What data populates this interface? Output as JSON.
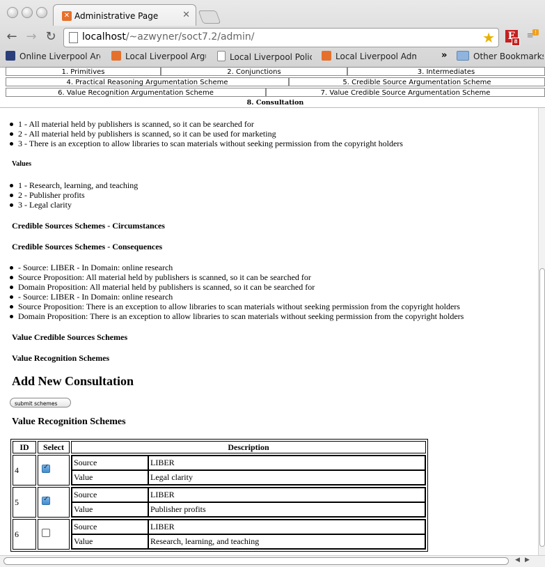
{
  "browser": {
    "tab_title": "Administrative Page",
    "url_host": "localhost",
    "url_path": "/~azwyner/soct7.2/admin/",
    "ext_badge": "8",
    "bookmarks": [
      {
        "label": "Online Liverpool Arg",
        "icon": "bird-icon"
      },
      {
        "label": "Local Liverpool Argu",
        "icon": "xampp-icon"
      },
      {
        "label": "Local Liverpool Polic",
        "icon": "page-icon"
      },
      {
        "label": "Local Liverpool Adm",
        "icon": "xampp-icon"
      }
    ],
    "bookmarks_more": "»",
    "other_bookmarks": "Other Bookmarks"
  },
  "nav": {
    "row1": [
      "1. Primitives",
      "2. Conjunctions",
      "3. Intermediates"
    ],
    "row2": [
      "4. Practical Reasoning Argumentation Scheme",
      "5. Credible Source Argumentation Scheme"
    ],
    "row3": [
      "6. Value Recognition Argumentation Scheme",
      "7. Value Credible Source Argumentation Scheme"
    ],
    "active": "8. Consultation"
  },
  "content": {
    "circumstances": [
      "1 - All material held by publishers is scanned, so it can be searched for",
      "2 - All material held by publishers is scanned, so it can be used for marketing",
      "3 - There is an exception to allow libraries to scan materials without seeking permission from the copyright holders"
    ],
    "values_heading": "Values",
    "values": [
      "1 - Research, learning, and teaching",
      "2 - Publisher profits",
      "3 - Legal clarity"
    ],
    "cs_circ_heading": "Credible Sources Schemes - Circumstances",
    "cs_cons_heading": "Credible Sources Schemes - Consequences",
    "cs_cons": [
      "- Source: LIBER - In Domain: online research",
      "Source Proposition: All material held by publishers is scanned, so it can be searched for",
      "Domain Proposition: All material held by publishers is scanned, so it can be searched for",
      "- Source: LIBER - In Domain: online research",
      "Source Proposition: There is an exception to allow libraries to scan materials without seeking permission from the copyright holders",
      "Domain Proposition: There is an exception to allow libraries to scan materials without seeking permission from the copyright holders"
    ],
    "vcs_heading": "Value Credible Sources Schemes",
    "vr_heading": "Value Recognition Schemes",
    "add_heading": "Add New Consultation",
    "submit_label": "submit schemes",
    "vr_heading2": "Value Recognition Schemes"
  },
  "table": {
    "headers": [
      "ID",
      "Select",
      "Description"
    ],
    "rows": [
      {
        "id": "4",
        "checked": true,
        "source_label": "Source",
        "source": "LIBER",
        "value_label": "Value",
        "value": "Legal clarity"
      },
      {
        "id": "5",
        "checked": true,
        "source_label": "Source",
        "source": "LIBER",
        "value_label": "Value",
        "value": "Publisher profits"
      },
      {
        "id": "6",
        "checked": false,
        "source_label": "Source",
        "source": "LIBER",
        "value_label": "Value",
        "value": "Research, learning, and teaching"
      }
    ]
  }
}
